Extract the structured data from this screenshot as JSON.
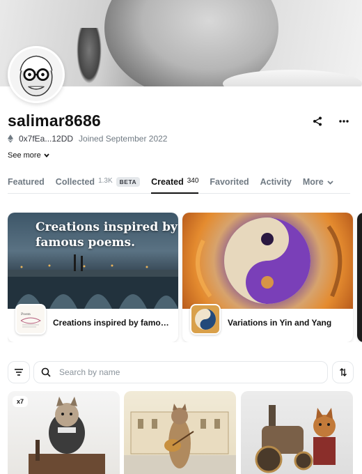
{
  "profile": {
    "username": "salimar8686",
    "address": "0x7fEa...12DD",
    "joined": "Joined September 2022",
    "see_more": "See more"
  },
  "tabs": [
    {
      "label": "Featured",
      "count": "",
      "badge": ""
    },
    {
      "label": "Collected",
      "count": "1.3K",
      "badge": "BETA"
    },
    {
      "label": "Created",
      "count": "340",
      "badge": ""
    },
    {
      "label": "Favorited",
      "count": "",
      "badge": ""
    },
    {
      "label": "Activity",
      "count": "",
      "badge": ""
    },
    {
      "label": "More",
      "count": "",
      "badge": ""
    }
  ],
  "active_tab": "Created",
  "featured": [
    {
      "name": "Creations inspired by famou...",
      "image_text": "Creations inspired by famous poems."
    },
    {
      "name": "Variations in Yin and Yang",
      "image_text": ""
    }
  ],
  "search": {
    "placeholder": "Search by name",
    "value": ""
  },
  "grid": [
    {
      "badge": "x7",
      "icon": "cat-captain-image"
    },
    {
      "badge": "",
      "icon": "cat-guitar-image"
    },
    {
      "badge": "",
      "icon": "cat-steampunk-image"
    }
  ],
  "icons": {
    "share": "share-icon",
    "more": "more-horizontal-icon",
    "filter": "filter-icon",
    "search": "search-icon",
    "sort": "sort-icon",
    "chevron": "chevron-down-icon",
    "eth": "ethereum-icon"
  },
  "colors": {
    "text": "#121212",
    "muted": "#707a83",
    "border": "#e5e8eb"
  }
}
